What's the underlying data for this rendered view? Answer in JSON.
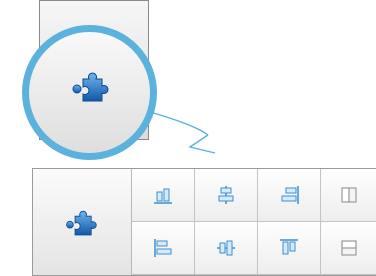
{
  "callout": {
    "icons": [
      "puzzle-piece-icon",
      "puzzle-piece-icon"
    ]
  },
  "ribbon": {
    "buttons": [
      {
        "icon": "align-bottom-icon"
      },
      {
        "icon": "align-center-vertical-icon"
      },
      {
        "icon": "align-right-icon"
      },
      {
        "icon": "distribute-columns-icon"
      },
      {
        "icon": "align-left-icon"
      },
      {
        "icon": "align-center-horizontal-icon"
      },
      {
        "icon": "align-top-icon"
      },
      {
        "icon": "distribute-rows-icon"
      }
    ]
  },
  "colors": {
    "highlight_circle": "#5ab2dd",
    "puzzle_blue": "#1f6fc2",
    "icon_blue": "#3b8fd0"
  }
}
